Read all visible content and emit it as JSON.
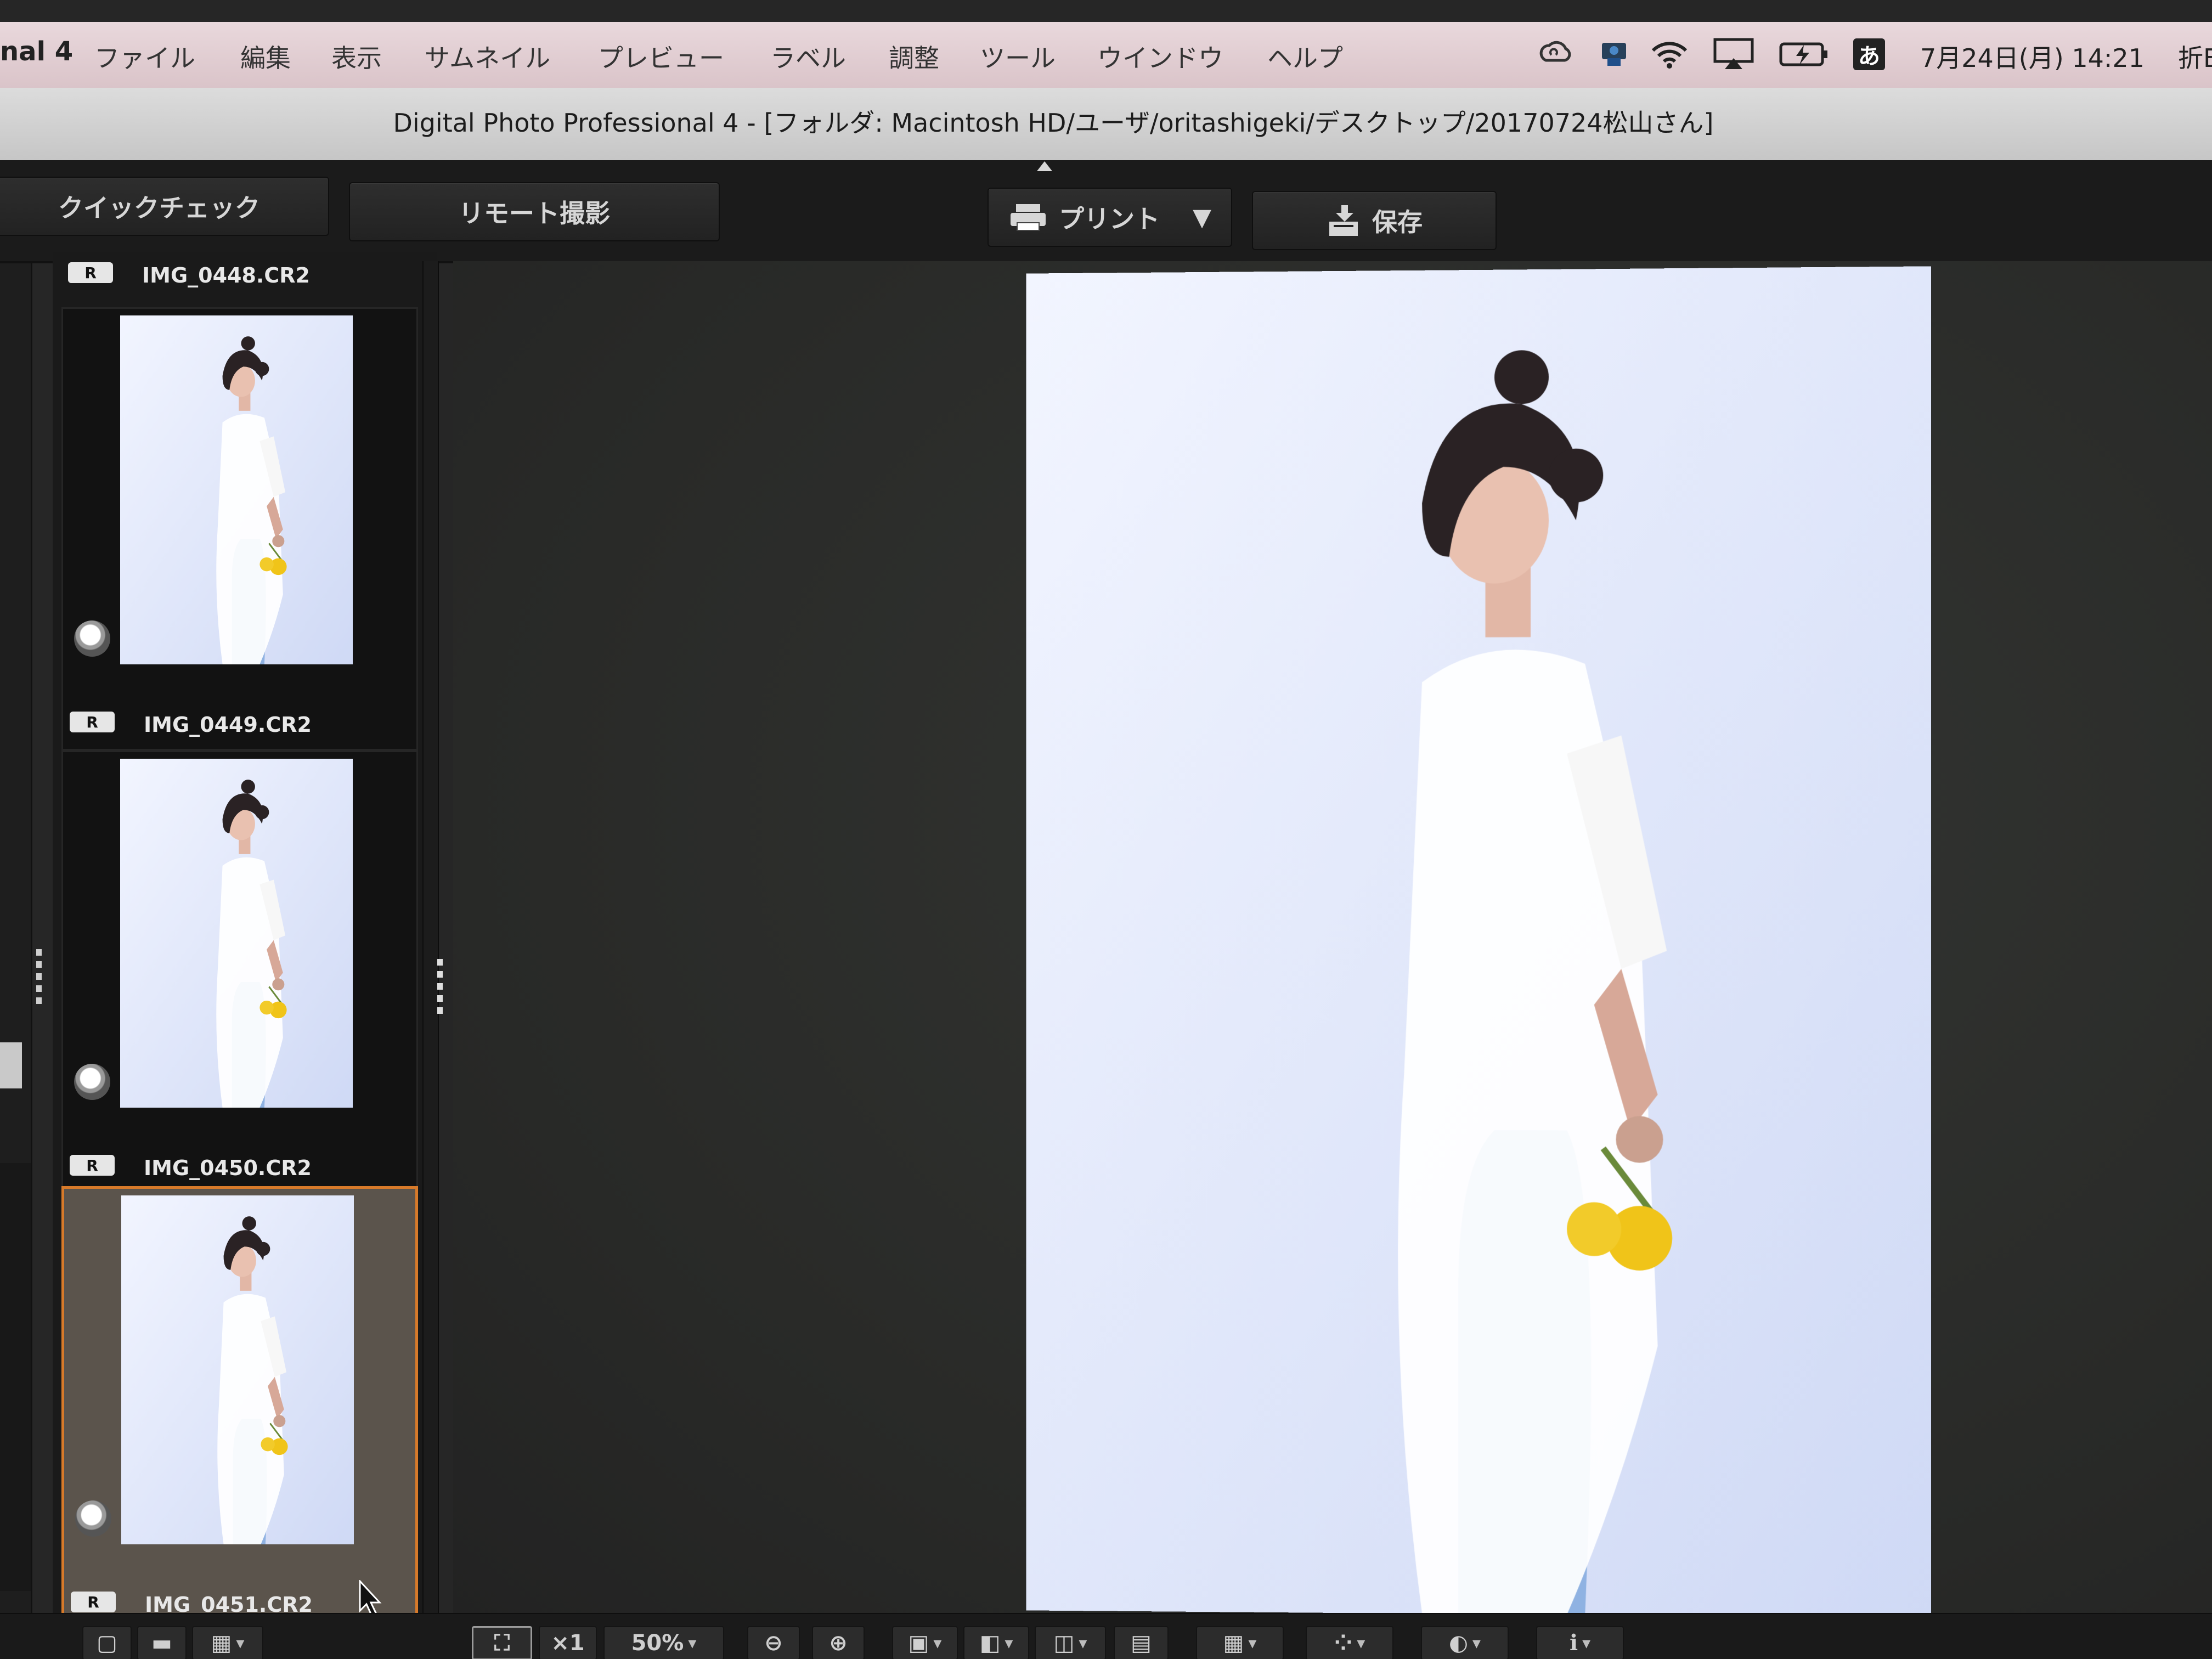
{
  "menubar": {
    "app_name": "nal 4",
    "menus": [
      "ファイル",
      "編集",
      "表示",
      "サムネイル",
      "プレビュー",
      "ラベル",
      "調整",
      "ツール",
      "ウインドウ",
      "ヘルプ"
    ],
    "tray_icons": [
      "creative-cloud-icon",
      "dropbox-icon",
      "wifi-icon",
      "airplay-icon",
      "battery-icon",
      "input-method-icon"
    ],
    "input_method": "あ",
    "clock": "7月24日(月)  14:21",
    "cut_text": "折E"
  },
  "window": {
    "title": "Digital Photo Professional 4 - [フォルダ: Macintosh HD/ユーザ/oritashigeki/デスクトップ/20170724松山さん]"
  },
  "toolbar": {
    "quick_check": "クイックチェック",
    "remote_shoot": "リモート撮影",
    "print": "プリント",
    "save": "保存"
  },
  "thumbnails": {
    "previous": {
      "badge": "R",
      "filename": "IMG_0448.CR2"
    },
    "items": [
      {
        "badge": "R",
        "filename": "IMG_0449.CR2",
        "selected": false
      },
      {
        "badge": "R",
        "filename": "IMG_0450.CR2",
        "selected": false
      },
      {
        "badge": "R",
        "filename": "IMG_0451.CR2",
        "selected": true
      }
    ]
  },
  "bottombar": {
    "magnify": "×1",
    "zoom": "50%"
  },
  "colors": {
    "selection": "#d77a2a",
    "menubar": "#e4d2d6",
    "preview_bg": "#2d2e2c",
    "photo_bg": "#e3e9fb"
  }
}
